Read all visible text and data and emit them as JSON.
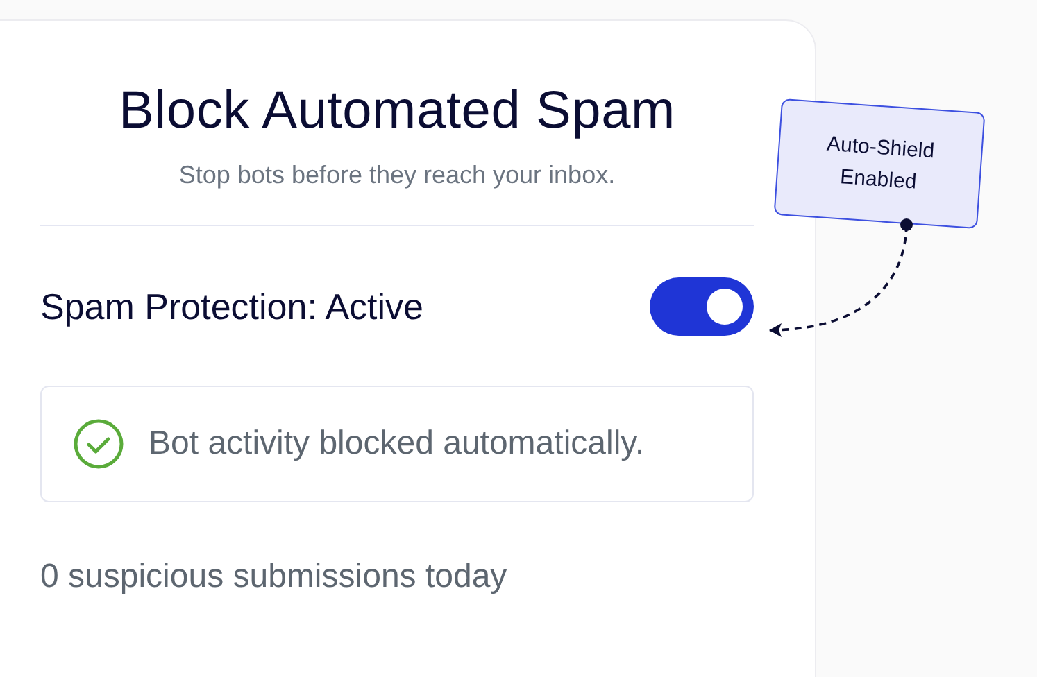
{
  "card": {
    "title": "Block Automated Spam",
    "subtitle": "Stop bots before they reach your inbox."
  },
  "setting": {
    "label": "Spam Protection: Active",
    "on": true
  },
  "notice": {
    "text": "Bot activity blocked automatically."
  },
  "footer": "0 suspicious submissions today",
  "callout": {
    "lines": [
      "Auto-Shield",
      "Enabled"
    ]
  }
}
